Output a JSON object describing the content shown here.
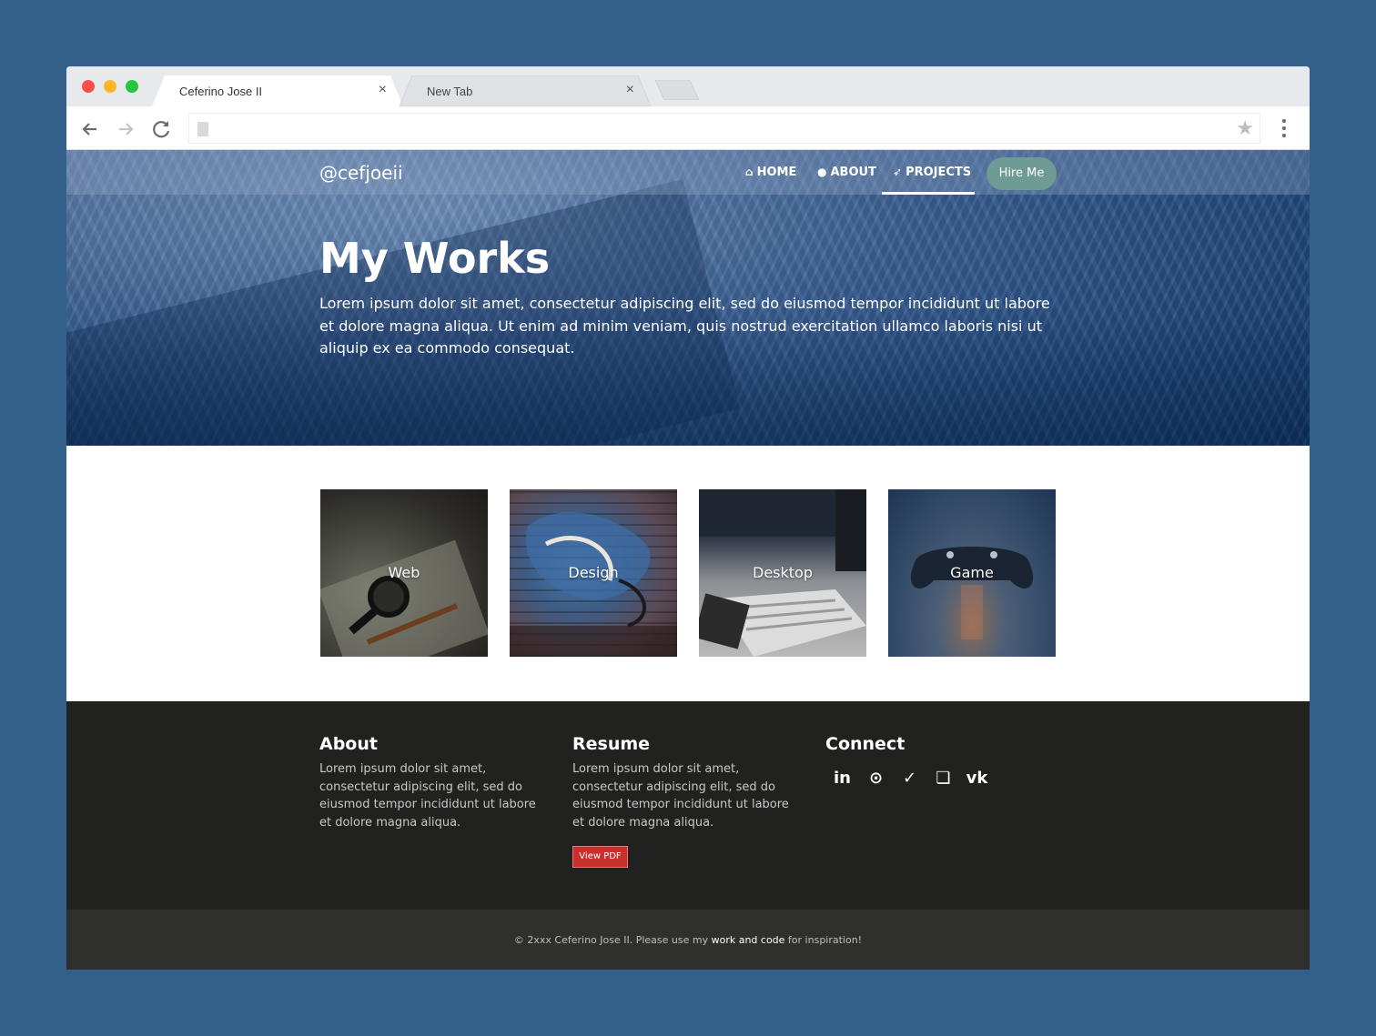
{
  "browser": {
    "tabs": [
      {
        "title": "Ceferino Jose II",
        "close": "×"
      },
      {
        "title": "New Tab",
        "close": "×"
      }
    ],
    "star": "★"
  },
  "site": {
    "brand": "@cefjoeii",
    "nav": [
      {
        "icon": "home-icon",
        "glyph": "⌂",
        "label": "HOME"
      },
      {
        "icon": "user-icon",
        "glyph": "●",
        "label": "ABOUT"
      },
      {
        "icon": "rocket-icon",
        "glyph": "➶",
        "label": "PROJECTS"
      }
    ],
    "active_nav": "PROJECTS",
    "hire_label": "Hire Me"
  },
  "hero": {
    "title": "My Works",
    "text": "Lorem ipsum dolor sit amet, consectetur adipiscing elit, sed do eiusmod tempor incididunt ut labore et dolore magna aliqua. Ut enim ad minim veniam, quis nostrud exercitation ullamco laboris nisi ut aliquip ex ea commodo consequat."
  },
  "works": [
    {
      "label": "Web"
    },
    {
      "label": "Design"
    },
    {
      "label": "Desktop"
    },
    {
      "label": "Game"
    }
  ],
  "footer": {
    "about": {
      "title": "About",
      "text": "Lorem ipsum dolor sit amet, consectetur adipiscing elit, sed do eiusmod tempor incididunt ut labore et dolore magna aliqua."
    },
    "resume": {
      "title": "Resume",
      "text": "Lorem ipsum dolor sit amet, consectetur adipiscing elit, sed do eiusmod tempor incididunt ut labore et dolore magna aliqua.",
      "button": "View PDF"
    },
    "connect": {
      "title": "Connect",
      "social": [
        {
          "icon": "linkedin-icon",
          "glyph": "in"
        },
        {
          "icon": "github-icon",
          "glyph": "⊙"
        },
        {
          "icon": "twitter-icon",
          "glyph": "✓"
        },
        {
          "icon": "book-icon",
          "glyph": "❏"
        },
        {
          "icon": "vk-icon",
          "glyph": "vk"
        }
      ]
    }
  },
  "copyright": {
    "prefix": "© 2xxx Ceferino Jose II. Please use my ",
    "highlight": "work and code",
    "suffix": " for inspiration!"
  },
  "colors": {
    "page_bg": "#335f8b",
    "hire_button": "#6e9b93",
    "pdf_button": "#c9302c",
    "footer_bg": "#212220",
    "copyright_bg": "#2f2f2e"
  }
}
